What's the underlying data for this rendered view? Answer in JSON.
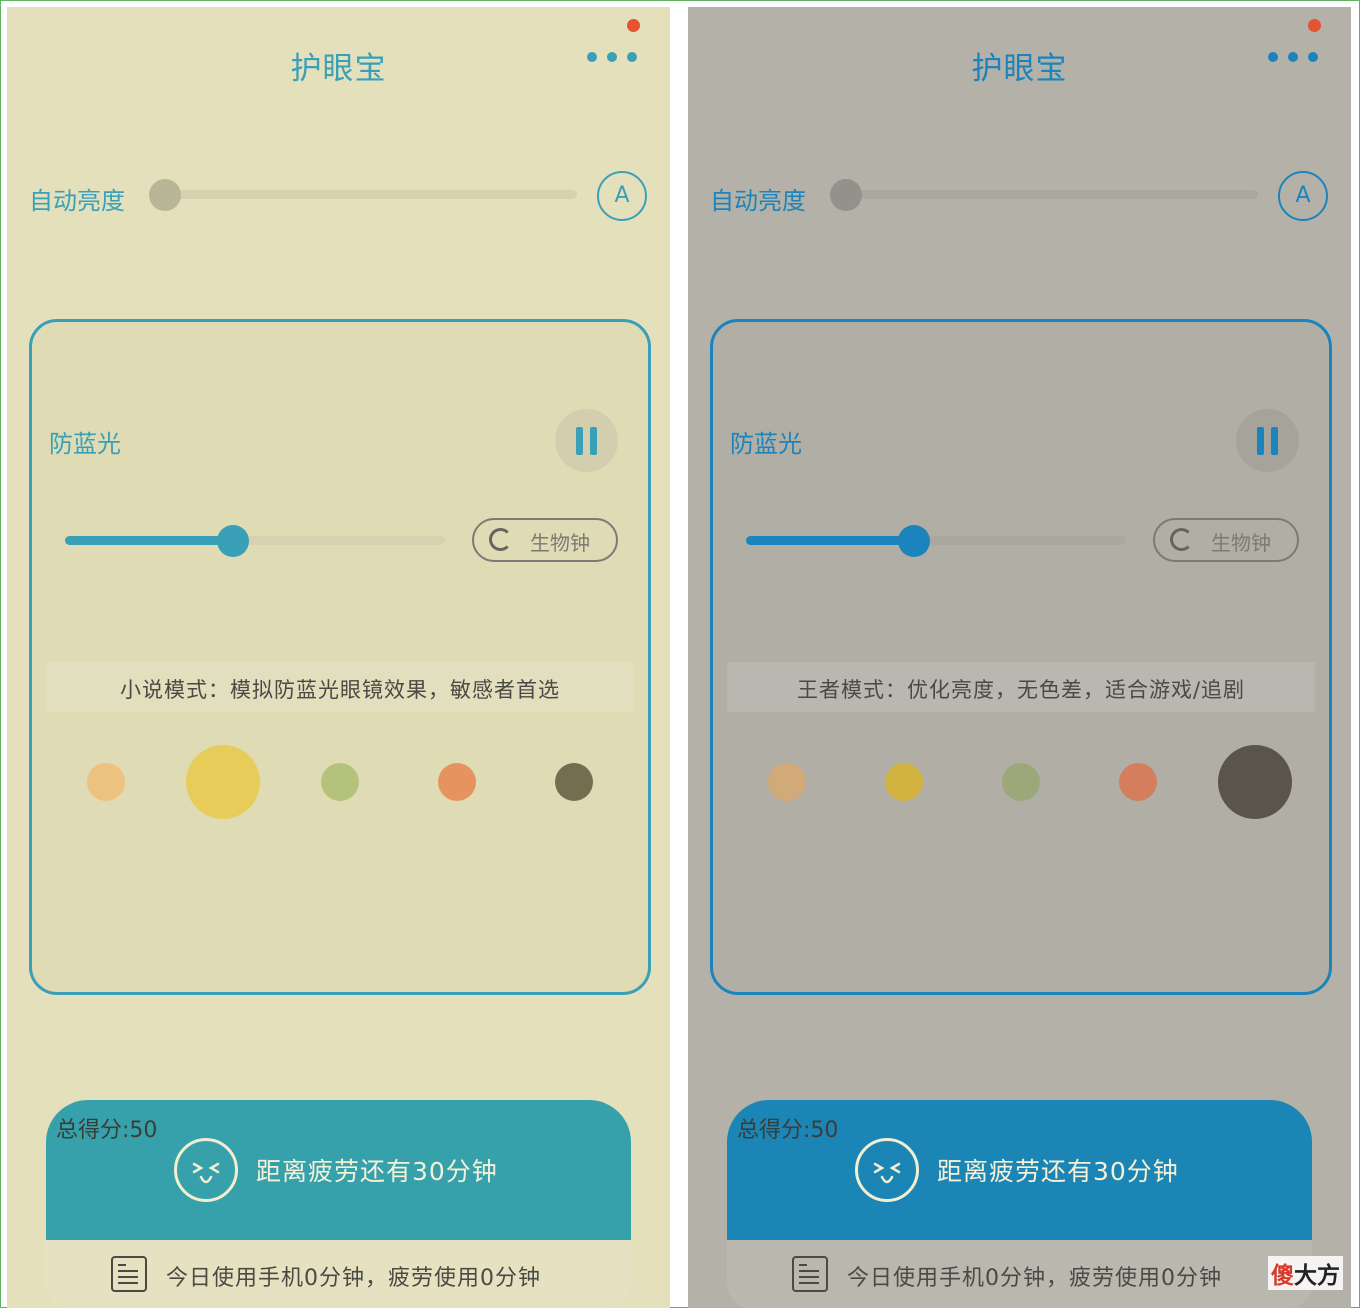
{
  "app": {
    "title": "护眼宝",
    "brightness_label": "自动亮度",
    "auto_label": "A",
    "filter_label": "防蓝光",
    "bio_label": "生物钟",
    "score_label": "总得分:50",
    "fatigue_text": "距离疲劳还有30分钟",
    "usage_text": "今日使用手机0分钟，疲劳使用0分钟"
  },
  "left": {
    "mode_text": "小说模式：模拟防蓝光眼镜效果，敏感者首选",
    "selected_swatch": 1,
    "filter_level": 0.44,
    "colors": {
      "bg": "#e4e0bc",
      "accent": "#3aa0b8",
      "card_bg": "#dedbb5",
      "track": "#d6d2b0",
      "knob": "#b9b698",
      "pause_bg": "#d2ceae",
      "score_bg": "#36a1ab"
    }
  },
  "right": {
    "mode_text": "王者模式：优化亮度，无色差，适合游戏/追剧",
    "selected_swatch": 4,
    "filter_level": 0.44,
    "colors": {
      "bg": "#b4b1a8",
      "accent": "#1c84bc",
      "card_bg": "#b1aea5",
      "track": "#aaa79f",
      "knob": "#94918a",
      "pause_bg": "#a6a39b",
      "score_bg": "#1b85b5"
    }
  },
  "left_swatches": [
    "#edc27e",
    "#e8cc5a",
    "#b4c27c",
    "#e7935f",
    "#746d50"
  ],
  "right_swatches": [
    "#d2a979",
    "#d2b33f",
    "#9ca87a",
    "#d47e5e",
    "#5a554c"
  ],
  "watermark": {
    "red": "傻",
    "black": "大方"
  }
}
